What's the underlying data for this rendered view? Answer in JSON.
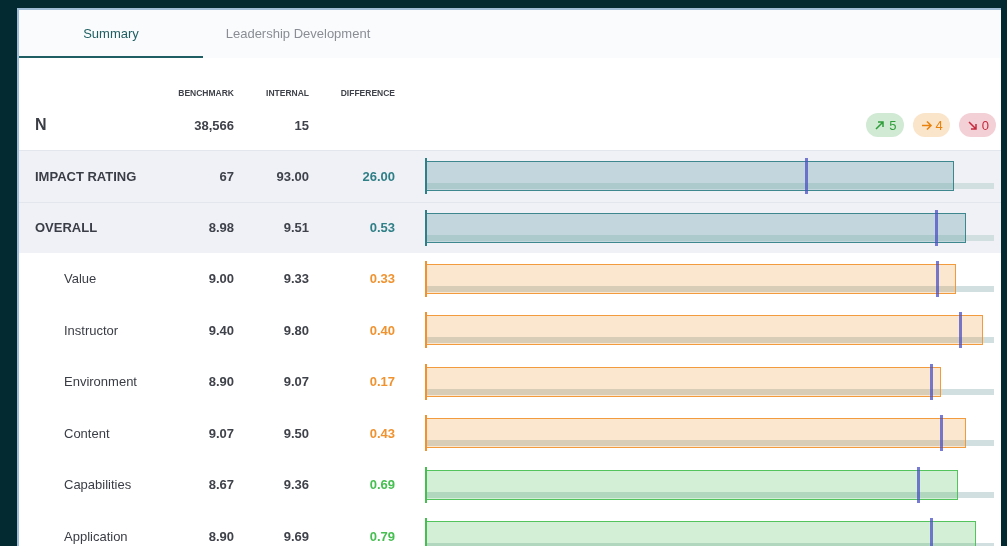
{
  "tabs": [
    {
      "label": "Summary",
      "selected": true
    },
    {
      "label": "Leadership Development",
      "selected": false
    }
  ],
  "columns": [
    "BENCHMARK",
    "INTERNAL",
    "DIFFERENCE"
  ],
  "n_row": {
    "label": "N",
    "benchmark": "38,566",
    "internal": "15"
  },
  "badges": [
    {
      "kind": "up",
      "color": "#2f9e3a",
      "count": "5"
    },
    {
      "kind": "flat",
      "color": "#e8820c",
      "count": "4"
    },
    {
      "kind": "down",
      "color": "#c72a3e",
      "count": "0"
    }
  ],
  "rows": [
    {
      "kind": "group",
      "label": "IMPACT RATING",
      "benchmark": "67",
      "internal": "93.00",
      "difference": "26.00",
      "color": "#2f7f86",
      "level": 0.93,
      "marker": {
        "level": 0.67
      }
    },
    {
      "kind": "group",
      "label": "OVERALL",
      "benchmark": "8.98",
      "internal": "9.51",
      "difference": "0.53",
      "color": "#2f7f86",
      "level": 0.951,
      "marker": {
        "level": 0.898
      }
    },
    {
      "kind": "item",
      "label": "Value",
      "benchmark": "9.00",
      "internal": "9.33",
      "difference": "0.33",
      "color": "#f0922e",
      "level": 0.933,
      "marker": {
        "level": 0.9
      }
    },
    {
      "kind": "item",
      "label": "Instructor",
      "benchmark": "9.40",
      "internal": "9.80",
      "difference": "0.40",
      "color": "#f0922e",
      "level": 0.98,
      "marker": {
        "level": 0.94
      }
    },
    {
      "kind": "item",
      "label": "Environment",
      "benchmark": "8.90",
      "internal": "9.07",
      "difference": "0.17",
      "color": "#f0922e",
      "level": 0.907,
      "marker": {
        "level": 0.89
      }
    },
    {
      "kind": "item",
      "label": "Content",
      "benchmark": "9.07",
      "internal": "9.50",
      "difference": "0.43",
      "color": "#f0922e",
      "level": 0.95,
      "marker": {
        "level": 0.907
      }
    },
    {
      "kind": "item",
      "label": "Capabilities",
      "benchmark": "8.67",
      "internal": "9.36",
      "difference": "0.69",
      "color": "#45bf50",
      "level": 0.936,
      "marker": {
        "level": 0.867
      }
    },
    {
      "kind": "item",
      "label": "Application",
      "benchmark": "8.90",
      "internal": "9.69",
      "difference": "0.79",
      "color": "#45bf50",
      "level": 0.969,
      "marker": {
        "level": 0.89
      }
    }
  ]
}
